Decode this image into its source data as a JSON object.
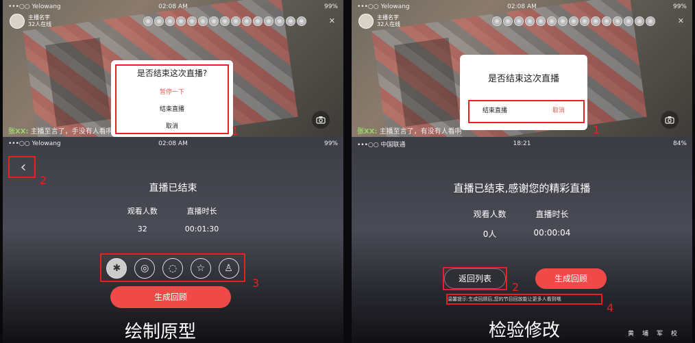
{
  "top_left": {
    "status": {
      "carrier": "•••○○ Yelowang",
      "time": "02:08 AM",
      "battery": "99%"
    },
    "host": {
      "name": "主播名字",
      "sub": "32人在线"
    },
    "close": "✕",
    "chat_name": "张XX:",
    "chat_text": "主播至言了，手没有人看啊",
    "dialog": {
      "title": "是否结束这次直播?",
      "options": [
        "暂停一下",
        "结束直播",
        "取消"
      ]
    },
    "marker": "1"
  },
  "top_right": {
    "status": {
      "carrier": "•••○○ Yelowang",
      "time": "02:08 AM",
      "battery": "99%"
    },
    "host": {
      "name": "主播名字",
      "sub": "32人在线"
    },
    "close": "✕",
    "chat_name": "张XX:",
    "chat_text": "主播至言了，有没有人看啊",
    "dialog": {
      "title": "是否结束这次直播",
      "confirm": "结束直播",
      "cancel": "取消"
    },
    "marker": "1"
  },
  "bottom_left": {
    "status": {
      "carrier": "•••○○ Yelowang",
      "time": "02:08 AM",
      "battery": "99%"
    },
    "back_marker": "2",
    "title": "直播已结束",
    "stats": [
      {
        "label": "观看人数",
        "value": "32"
      },
      {
        "label": "直播时长",
        "value": "00:01:30"
      }
    ],
    "share_icons": [
      "moments-icon",
      "wechat-icon",
      "weibo-icon",
      "qzone-icon",
      "qq-icon"
    ],
    "share_marker": "3",
    "generate": "生成回顾",
    "caption": "绘制原型"
  },
  "bottom_right": {
    "status": {
      "carrier": "•••○○ 中国联通",
      "time": "18:21",
      "battery": "84%"
    },
    "title": "直播已结束,感谢您的精彩直播",
    "stats": [
      {
        "label": "观看人数",
        "value": "0人"
      },
      {
        "label": "直播时长",
        "value": "00:00:04"
      }
    ],
    "back_list": "返回列表",
    "generate": "生成回顾",
    "tip": "温馨提示:生成回顾后,您的节目回放能让更多人看到哦",
    "marker2": "2",
    "marker4": "4",
    "caption": "检验修改",
    "school": "黄埔军校"
  }
}
